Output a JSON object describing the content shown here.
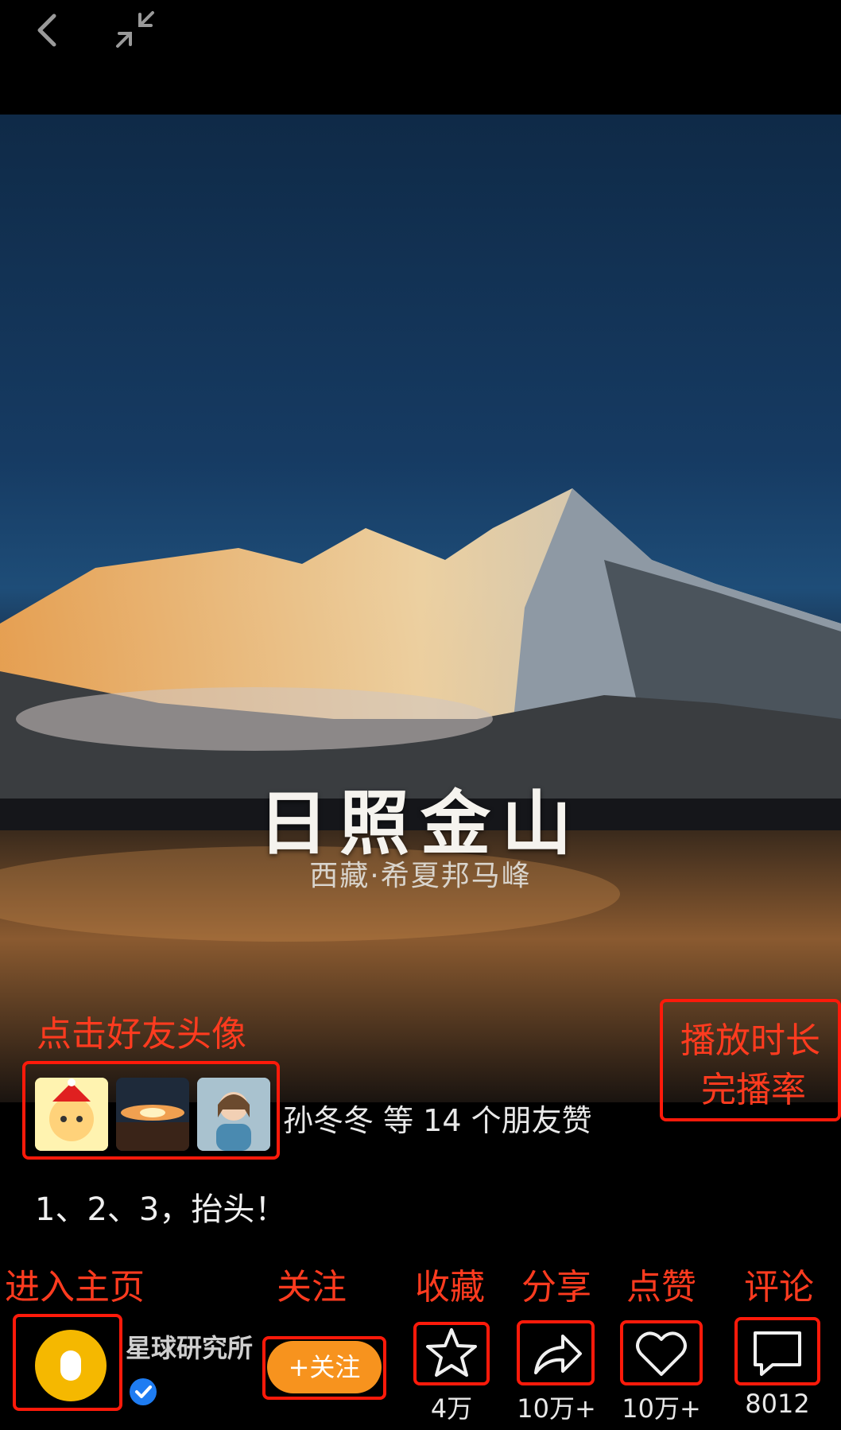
{
  "video": {
    "title": "日照金山",
    "subtitle": "西藏·希夏邦马峰"
  },
  "friends": {
    "likes_text": "孙冬冬 等 14 个朋友赞"
  },
  "post": {
    "caption": "1、2、3，抬头！"
  },
  "author": {
    "name": "星球研究所",
    "follow_label": "+关注"
  },
  "actions": {
    "favorite_count": "4万",
    "share_count": "10万+",
    "like_count": "10万+",
    "comment_count": "8012"
  },
  "annotations": {
    "friend_avatars": "点击好友头像",
    "play_duration_line1": "播放时长",
    "play_duration_line2": "完播率",
    "enter_homepage": "进入主页",
    "follow": "关注",
    "favorite": "收藏",
    "share": "分享",
    "like": "点赞",
    "comment": "评论"
  },
  "colors": {
    "annotation_red": "#ff1a0a",
    "follow_orange": "#f7931e",
    "avatar_yellow": "#f5b800",
    "verified_blue": "#1e7cf2"
  },
  "icons": [
    "back-icon",
    "minimize-icon",
    "star-icon",
    "share-arrow-icon",
    "heart-icon",
    "comment-icon",
    "verified-icon"
  ]
}
